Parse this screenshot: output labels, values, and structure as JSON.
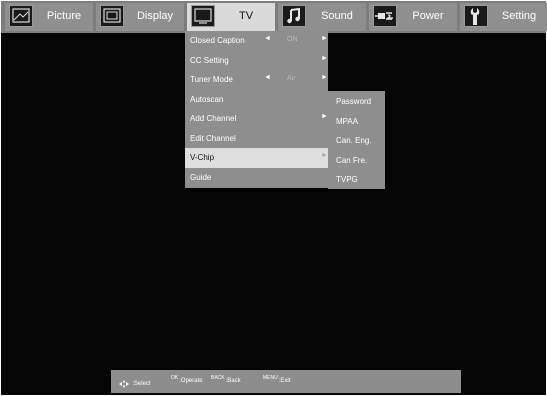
{
  "topbar": {
    "tabs": [
      {
        "label": "Picture",
        "icon": "picture-icon",
        "active": false
      },
      {
        "label": "Display",
        "icon": "display-icon",
        "active": false
      },
      {
        "label": "TV",
        "icon": "tv-icon",
        "active": true
      },
      {
        "label": "Sound",
        "icon": "music-note-icon",
        "active": false
      },
      {
        "label": "Power",
        "icon": "power-plug-icon",
        "active": false
      },
      {
        "label": "Setting",
        "icon": "wrench-icon",
        "active": false
      }
    ]
  },
  "tv_menu": {
    "items": [
      {
        "label": "Closed Caption",
        "value": "ON",
        "has_left_arrow": true,
        "has_right_arrow": true
      },
      {
        "label": "CC Setting",
        "value": "",
        "has_left_arrow": false,
        "has_right_arrow": true
      },
      {
        "label": "Tuner Mode",
        "value": "Air",
        "has_left_arrow": true,
        "has_right_arrow": true
      },
      {
        "label": "Autoscan",
        "value": "",
        "has_left_arrow": false,
        "has_right_arrow": false
      },
      {
        "label": "Add Channel",
        "value": "",
        "has_left_arrow": false,
        "has_right_arrow": true
      },
      {
        "label": "Edit Channel",
        "value": "",
        "has_left_arrow": false,
        "has_right_arrow": false
      },
      {
        "label": "V-Chip",
        "value": "",
        "has_left_arrow": false,
        "has_right_arrow": true,
        "selected": true
      },
      {
        "label": "Guide",
        "value": "",
        "has_left_arrow": false,
        "has_right_arrow": false
      }
    ]
  },
  "vchip_submenu": {
    "items": [
      "Password",
      "MPAA",
      "Can. Eng.",
      "Can Fre.",
      "TVPG"
    ]
  },
  "hints": {
    "select": {
      "key": "",
      "text": ":Select"
    },
    "operate": {
      "key": "OK",
      "text": ":Operate"
    },
    "back": {
      "key": "BACK",
      "text": ":Back"
    },
    "exit": {
      "key": "MENU",
      "text": ":Exit"
    }
  },
  "arrows": {
    "left": "◄",
    "right": "►"
  },
  "colors": {
    "background": "#050505",
    "menu": "#8e8e8e",
    "selected": "#dedede",
    "topbar": "#7c7c7c"
  }
}
